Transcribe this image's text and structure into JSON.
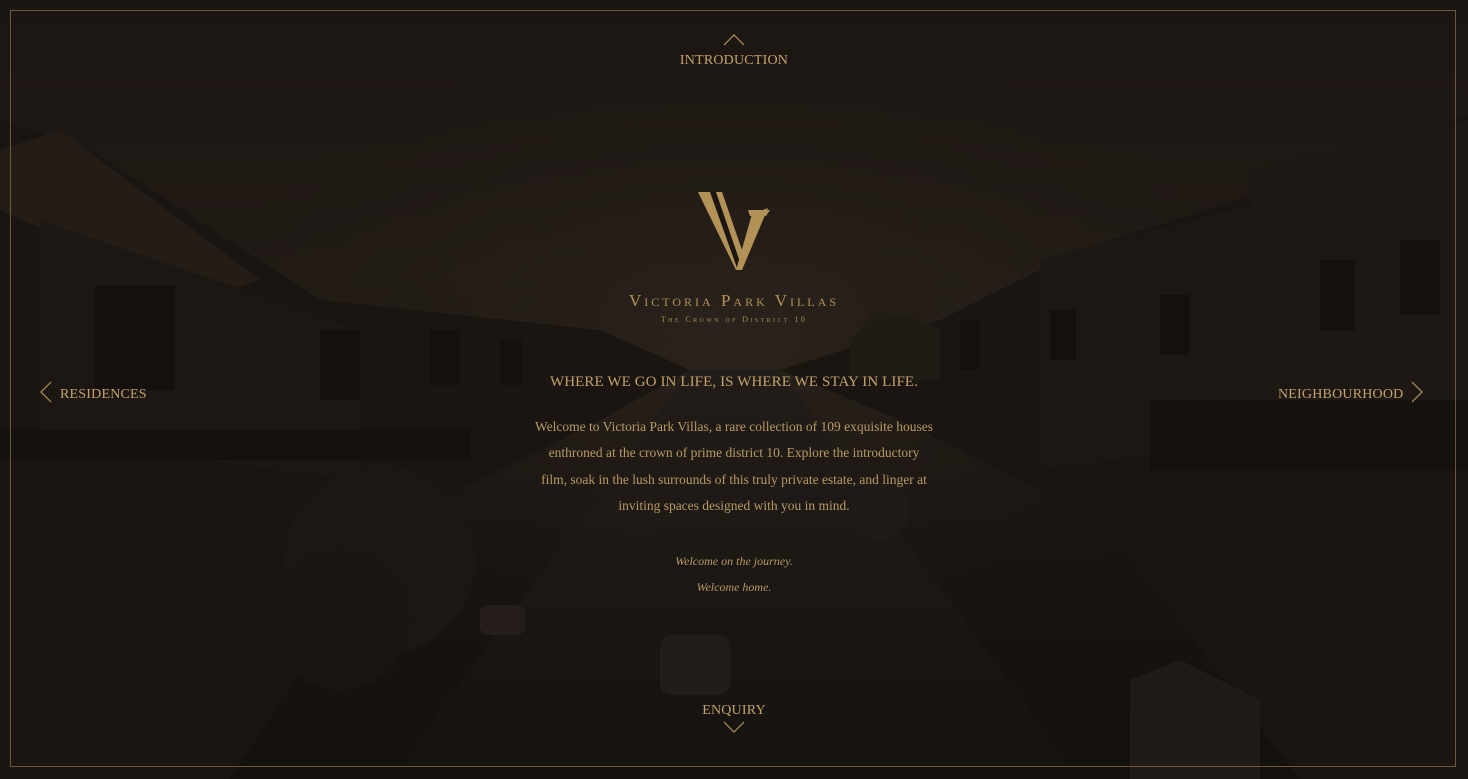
{
  "nav": {
    "top_label": "INTRODUCTION",
    "bottom_label": "ENQUIRY",
    "left_label": "RESIDENCES",
    "right_label": "NEIGHBOURHOOD"
  },
  "brand": {
    "name": "Victoria Park Villas",
    "tagline": "The Crown of District 10"
  },
  "content": {
    "headline": "WHERE WE GO IN LIFE, IS WHERE WE STAY IN LIFE.",
    "body": "Welcome to Victoria Park Villas, a rare collection of 109 exquisite houses enthroned at the crown of prime district 10. Explore the introductory film, soak in the lush surrounds of this truly private estate, and linger at inviting spaces designed with you in mind.",
    "closing_line_1": "Welcome on the journey.",
    "closing_line_2": "Welcome home."
  },
  "icons": {
    "top": "chevron-up-icon",
    "bottom": "chevron-down-icon",
    "left": "chevron-left-icon",
    "right": "chevron-right-icon",
    "logo": "monogram-v-icon"
  },
  "colors": {
    "accent": "#b39258",
    "background": "#1b1612"
  }
}
